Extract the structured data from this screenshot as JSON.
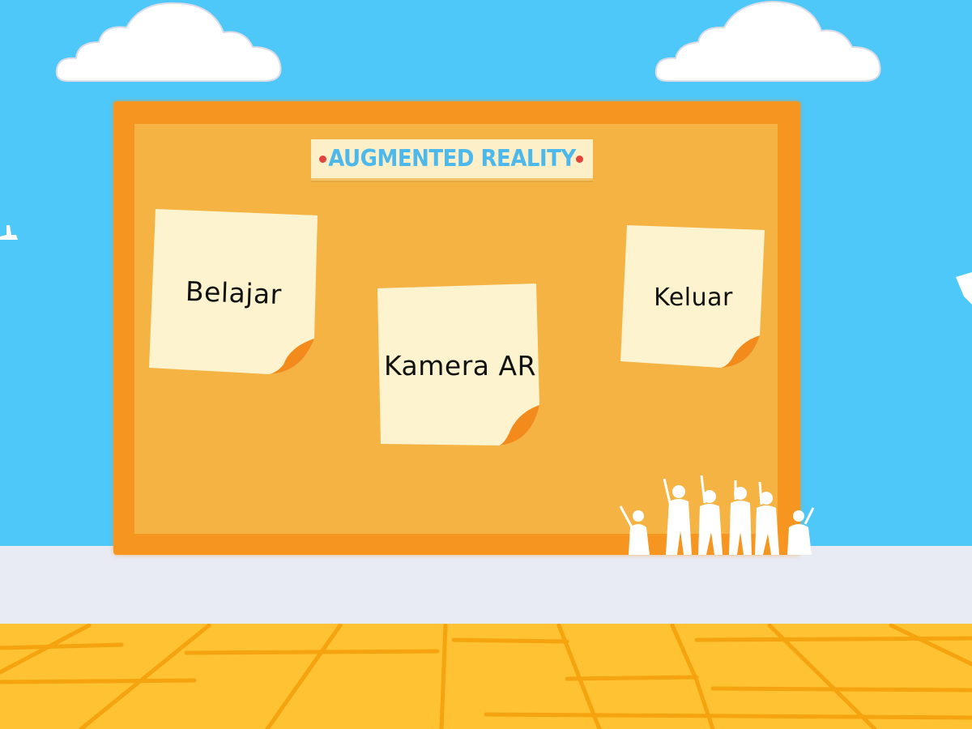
{
  "board": {
    "title": "AUGMENTED REALITY"
  },
  "menu": {
    "items": [
      {
        "label": "Belajar"
      },
      {
        "label": "Kamera AR"
      },
      {
        "label": "Keluar"
      }
    ]
  },
  "colors": {
    "sky": "#4dc8f9",
    "board_frame": "#f6951f",
    "board_cork": "#f4b343",
    "note_paper": "#fdf3cf",
    "note_curl": "#f28a1c",
    "title_text": "#4db8ec",
    "pin": "#e2433b",
    "wall": "#e9ebf4",
    "floor": "#fec233",
    "floor_lines": "#f5a30f"
  },
  "icons": [
    "cloud-icon",
    "plane-icon",
    "soldiers-silhouette-icon",
    "pushpin-icon"
  ]
}
